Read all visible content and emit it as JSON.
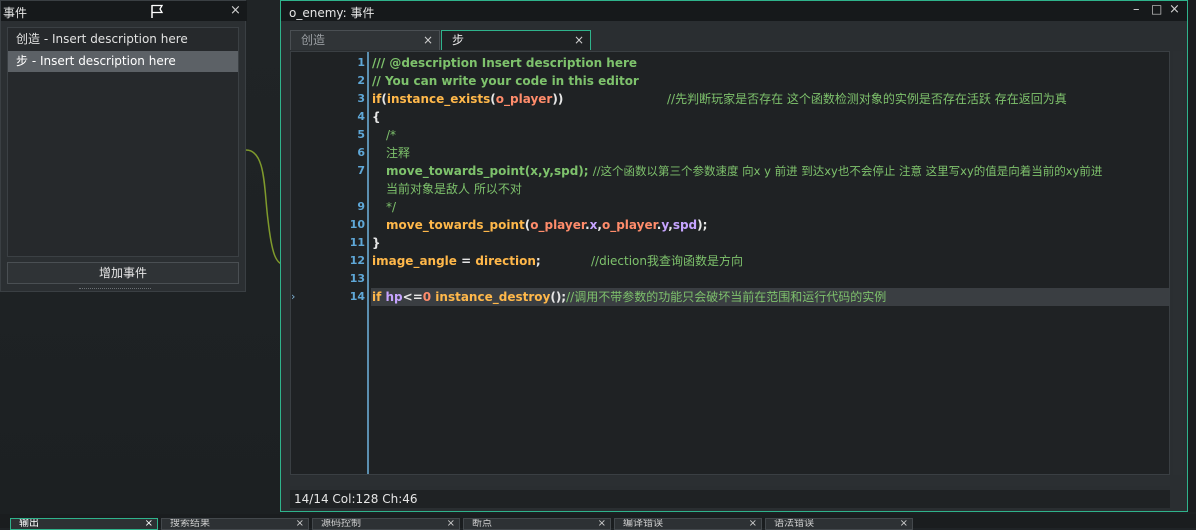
{
  "events_panel": {
    "title": "事件",
    "close": "×",
    "items": [
      {
        "label": "创造 - Insert description here",
        "selected": false
      },
      {
        "label": "步 - Insert description here",
        "selected": true
      }
    ],
    "add_button": "增加事件"
  },
  "editor": {
    "title": "o_enemy: 事件",
    "min": "–",
    "max": "□",
    "close": "×",
    "tabs": [
      {
        "label": "创造",
        "active": false,
        "close": "×"
      },
      {
        "label": "步",
        "active": true,
        "close": "×"
      }
    ],
    "lines": [
      {
        "n": "1"
      },
      {
        "n": "2"
      },
      {
        "n": "3"
      },
      {
        "n": "4"
      },
      {
        "n": "5"
      },
      {
        "n": "6"
      },
      {
        "n": "7"
      },
      {
        "n": ""
      },
      {
        "n": "9"
      },
      {
        "n": "10"
      },
      {
        "n": "11"
      },
      {
        "n": "12"
      },
      {
        "n": "13"
      },
      {
        "n": "14"
      }
    ],
    "code": {
      "l1": "/// @description Insert description here",
      "l2": "// You can write your code in this editor",
      "l3a": "if",
      "l3b": "(",
      "l3c": "instance_exists",
      "l3d": "(",
      "l3e": "o_player",
      "l3f": "))",
      "l3g": "//先判断玩家是否存在 这个函数检测对象的实例是否存在活跃 存在返回为真",
      "l4": "{",
      "l5": "/*",
      "l6": "注释",
      "l7a": "move_towards_point",
      "l7b": "(x,y,spd); ",
      "l7c": "//这个函数以第三个参数速度 向x y 前进 到达xy也不会停止 注意 这里写xy的值是向着当前的xy前进",
      "l8": "当前对象是敌人 所以不对",
      "l9": "*/",
      "l10a": "move_towards_point",
      "l10b": "(",
      "l10c": "o_player",
      "l10d": ".",
      "l10e": "x",
      "l10f": ",",
      "l10g": "o_player",
      "l10h": ".",
      "l10i": "y",
      "l10j": ",",
      "l10k": "spd",
      "l10l": ");",
      "l11": "}",
      "l12a": "image_angle",
      "l12b": " = ",
      "l12c": "direction",
      "l12d": ";",
      "l12e": "//diection我查询函数是方向",
      "l14a": "if ",
      "l14b": "hp",
      "l14c": "<=",
      "l14d": "0",
      "l14e": "  instance_destroy",
      "l14f": "();",
      "l14g": "//调用不带参数的功能只会破坏当前在范围和运行代码的实例"
    },
    "caret_symbol": "›",
    "status": "14/14 Col:128 Ch:46"
  },
  "bottom_tabs": [
    {
      "label": "输出",
      "active": true
    },
    {
      "label": "搜索结果",
      "active": false
    },
    {
      "label": "源码控制",
      "active": false
    },
    {
      "label": "断点",
      "active": false
    },
    {
      "label": "编译错误",
      "active": false
    },
    {
      "label": "语法错误",
      "active": false
    }
  ],
  "colors": {
    "accent": "#2fb38c",
    "line_numbers": "#5fa8d8",
    "comment": "#7ec26c",
    "keyword": "#ffb84a",
    "object": "#ff8c6b"
  }
}
